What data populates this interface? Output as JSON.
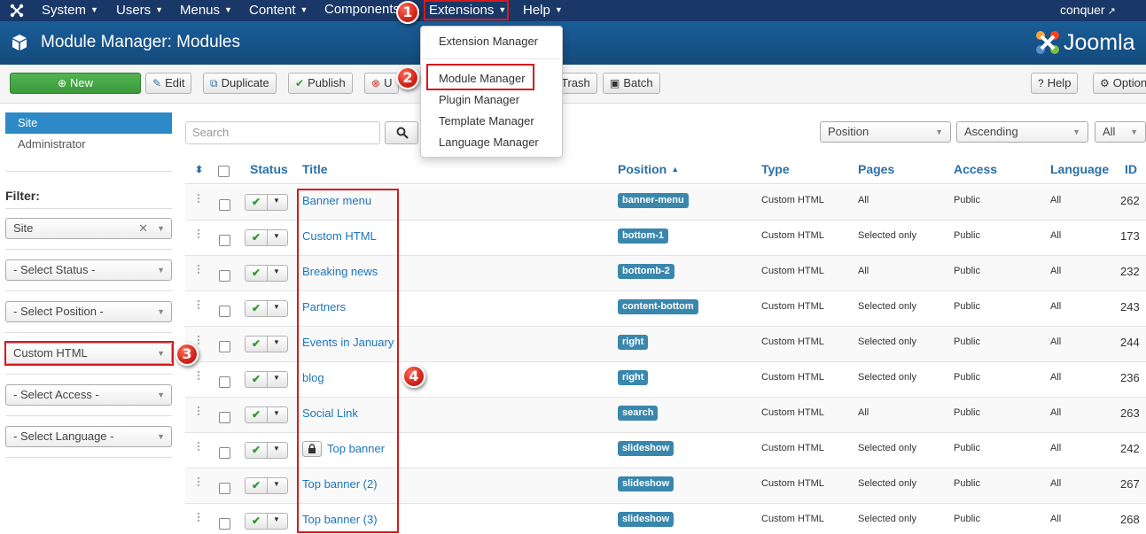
{
  "topnav": {
    "items": [
      {
        "label": "System"
      },
      {
        "label": "Users"
      },
      {
        "label": "Menus"
      },
      {
        "label": "Content"
      },
      {
        "label": "Components"
      },
      {
        "label": "Extensions"
      },
      {
        "label": "Help"
      }
    ],
    "user": "conquer"
  },
  "header": {
    "title": "Module Manager: Modules",
    "brand": "Joomla"
  },
  "toolbar": {
    "new": "New",
    "edit": "Edit",
    "duplicate": "Duplicate",
    "publish": "Publish",
    "unpublish": "U",
    "trash": "Trash",
    "batch": "Batch",
    "help": "Help",
    "options": "Option"
  },
  "extensions_menu": {
    "items": [
      "Extension Manager",
      "Module Manager",
      "Plugin Manager",
      "Template Manager",
      "Language Manager"
    ]
  },
  "sidebar": {
    "items": [
      "Site",
      "Administrator"
    ],
    "filter_label": "Filter:",
    "filters": {
      "client": "Site",
      "status": "- Select Status -",
      "position": "- Select Position -",
      "type": "Custom HTML",
      "access": "- Select Access -",
      "language": "- Select Language -"
    }
  },
  "search": {
    "placeholder": "Search"
  },
  "sort": {
    "field": "Position",
    "direction": "Ascending",
    "limit": "All"
  },
  "table": {
    "columns": [
      "Status",
      "Title",
      "Position",
      "Type",
      "Pages",
      "Access",
      "Language",
      "ID"
    ],
    "rows": [
      {
        "title": "Banner menu",
        "position": "banner-menu",
        "type": "Custom HTML",
        "pages": "All",
        "access": "Public",
        "language": "All",
        "id": "262",
        "locked": false
      },
      {
        "title": "Custom HTML",
        "position": "bottom-1",
        "type": "Custom HTML",
        "pages": "Selected only",
        "access": "Public",
        "language": "All",
        "id": "173",
        "locked": false
      },
      {
        "title": "Breaking news",
        "position": "bottomb-2",
        "type": "Custom HTML",
        "pages": "All",
        "access": "Public",
        "language": "All",
        "id": "232",
        "locked": false
      },
      {
        "title": "Partners",
        "position": "content-bottom",
        "type": "Custom HTML",
        "pages": "Selected only",
        "access": "Public",
        "language": "All",
        "id": "243",
        "locked": false
      },
      {
        "title": "Events in January",
        "position": "right",
        "type": "Custom HTML",
        "pages": "Selected only",
        "access": "Public",
        "language": "All",
        "id": "244",
        "locked": false
      },
      {
        "title": "blog",
        "position": "right",
        "type": "Custom HTML",
        "pages": "Selected only",
        "access": "Public",
        "language": "All",
        "id": "236",
        "locked": false
      },
      {
        "title": "Social Link",
        "position": "search",
        "type": "Custom HTML",
        "pages": "All",
        "access": "Public",
        "language": "All",
        "id": "263",
        "locked": false
      },
      {
        "title": "Top banner",
        "position": "slideshow",
        "type": "Custom HTML",
        "pages": "Selected only",
        "access": "Public",
        "language": "All",
        "id": "242",
        "locked": true
      },
      {
        "title": "Top banner (2)",
        "position": "slideshow",
        "type": "Custom HTML",
        "pages": "Selected only",
        "access": "Public",
        "language": "All",
        "id": "267",
        "locked": false
      },
      {
        "title": "Top banner (3)",
        "position": "slideshow",
        "type": "Custom HTML",
        "pages": "Selected only",
        "access": "Public",
        "language": "All",
        "id": "268",
        "locked": false
      }
    ]
  },
  "annotations": [
    "1",
    "2",
    "3",
    "4"
  ],
  "colors": {
    "nav_bg": "#1a3867",
    "header_bg": "#17568c",
    "link": "#1c75bc",
    "badge_position": "#3a87ad",
    "new_button": "#46a546",
    "highlight_box": "#d6191f"
  }
}
